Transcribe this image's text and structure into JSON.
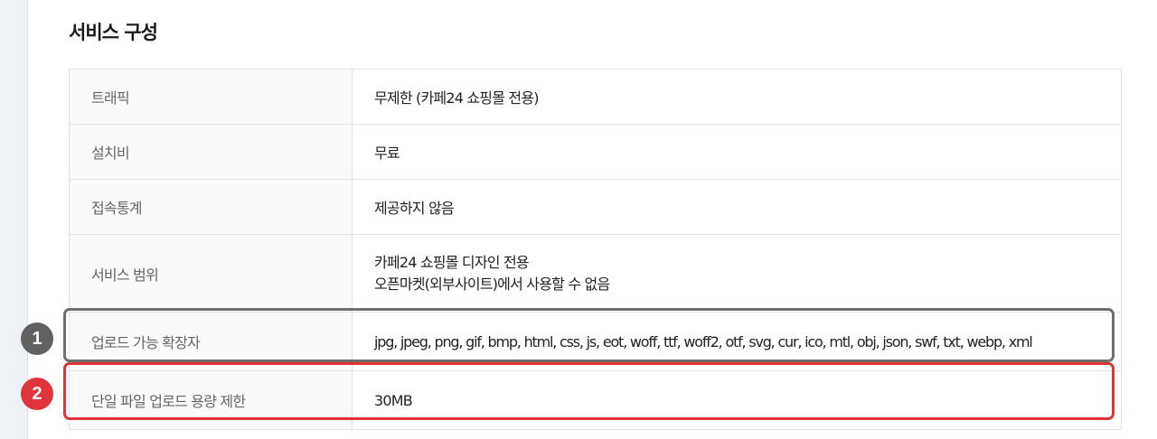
{
  "section": {
    "title": "서비스 구성"
  },
  "rows": [
    {
      "label": "트래픽",
      "values": [
        "무제한 (카페24 쇼핑몰 전용)"
      ]
    },
    {
      "label": "설치비",
      "values": [
        "무료"
      ]
    },
    {
      "label": "접속통계",
      "values": [
        "제공하지 않음"
      ]
    },
    {
      "label": "서비스 범위",
      "values": [
        "카페24 쇼핑몰 디자인 전용",
        "오픈마켓(외부사이트)에서 사용할 수 없음"
      ]
    },
    {
      "label": "업로드 가능 확장자",
      "values": [
        "jpg, jpeg, png, gif, bmp, html, css, js, eot, woff, ttf, woff2, otf, svg, cur, ico, mtl, obj, json, swf, txt, webp, xml"
      ]
    },
    {
      "label": "단일 파일 업로드 용량 제한",
      "values": [
        "30MB"
      ]
    }
  ],
  "annotations": [
    {
      "number": "1",
      "color": "#6e6e6e"
    },
    {
      "number": "2",
      "color": "#e0343a"
    }
  ]
}
